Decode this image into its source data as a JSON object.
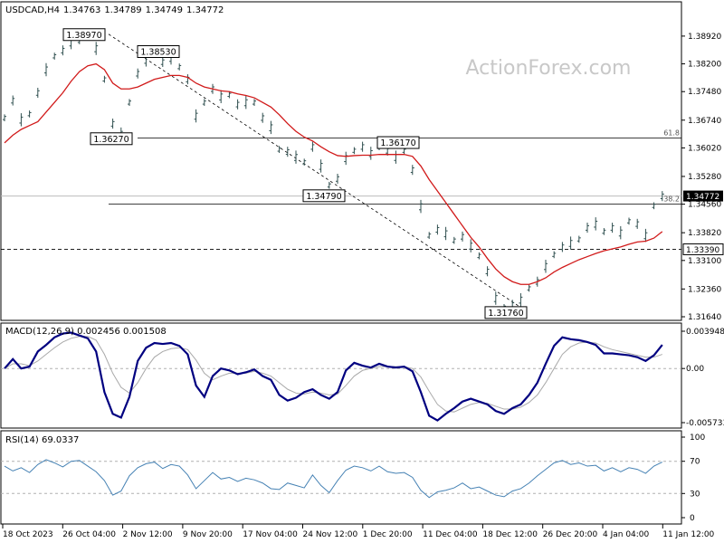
{
  "chart_data": [
    {
      "panel": "price",
      "type": "candlestick",
      "title": "USDCAD,H4",
      "ohlc": [
        "1.34763",
        "1.34789",
        "1.34749",
        "1.34772"
      ],
      "watermark": "ActionForex.com",
      "ylim": [
        1.3164,
        1.3934
      ],
      "yticks": [
        "1.38920",
        "1.38200",
        "1.37480",
        "1.36740",
        "1.36020",
        "1.35280",
        "1.34560",
        "1.33820",
        "1.33100",
        "1.32360",
        "1.31640"
      ],
      "price_tag": "1.34772",
      "level_tag": "1.33390",
      "xticks": [
        "18 Oct 2023",
        "26 Oct 04:00",
        "2 Nov 12:00",
        "9 Nov 20:00",
        "17 Nov 04:00",
        "24 Nov 12:00",
        "1 Dec 20:00",
        "11 Dec 04:00",
        "18 Dec 12:00",
        "26 Dec 20:00",
        "4 Jan 04:00",
        "11 Jan 12:00"
      ],
      "series": [
        {
          "values": [
            1.368,
            1.3725,
            1.3675,
            1.369,
            1.3745,
            1.3805,
            1.384,
            1.3855,
            1.3875,
            1.388,
            1.3895,
            1.386,
            1.378,
            1.3665,
            1.3638,
            1.372,
            1.3795,
            1.383,
            1.3845,
            1.3825,
            1.3835,
            1.3812,
            1.378,
            1.3685,
            1.372,
            1.3755,
            1.3735,
            1.374,
            1.3715,
            1.372,
            1.372,
            1.368,
            1.3655,
            1.3598,
            1.3592,
            1.3578,
            1.3565,
            1.3605,
            1.3555,
            1.3505,
            1.3522,
            1.3575,
            1.3595,
            1.3605,
            1.3588,
            1.3605,
            1.3595,
            1.3578,
            1.3595,
            1.3545,
            1.345,
            1.3375,
            1.339,
            1.338,
            1.3362,
            1.3372,
            1.3348,
            1.3322,
            1.3282,
            1.3212,
            1.3188,
            1.3195,
            1.3208,
            1.3238,
            1.3255,
            1.3295,
            1.3325,
            1.3345,
            1.3355,
            1.3365,
            1.3395,
            1.3405,
            1.3385,
            1.3395,
            1.3382,
            1.3412,
            1.3405,
            1.3375,
            1.3452,
            1.3477
          ]
        },
        {
          "values": [
            1.3615,
            1.3635,
            1.365,
            1.366,
            1.367,
            1.3695,
            1.372,
            1.3745,
            1.3775,
            1.38,
            1.3815,
            1.382,
            1.3805,
            1.377,
            1.3755,
            1.3755,
            1.376,
            1.377,
            1.378,
            1.3785,
            1.379,
            1.379,
            1.3785,
            1.377,
            1.376,
            1.3755,
            1.375,
            1.3748,
            1.3742,
            1.3738,
            1.3732,
            1.372,
            1.3708,
            1.3688,
            1.3665,
            1.3645,
            1.363,
            1.362,
            1.3605,
            1.3592,
            1.3582,
            1.358,
            1.3582,
            1.3583,
            1.3583,
            1.3585,
            1.3585,
            1.3585,
            1.3585,
            1.358,
            1.3555,
            1.352,
            1.349,
            1.346,
            1.343,
            1.34,
            1.337,
            1.3345,
            1.3315,
            1.3288,
            1.3268,
            1.3255,
            1.3248,
            1.3248,
            1.3255,
            1.3265,
            1.328,
            1.3292,
            1.3302,
            1.3312,
            1.332,
            1.3328,
            1.3335,
            1.334,
            1.3345,
            1.3352,
            1.3358,
            1.336,
            1.3368,
            1.3385
          ]
        }
      ],
      "callouts": [
        "1.38970",
        "1.38530",
        "1.36270",
        "1.34790",
        "1.36170",
        "1.31760"
      ],
      "fib_labels": [
        "61.8",
        "38.2"
      ]
    },
    {
      "panel": "macd",
      "type": "line",
      "title": "MACD(12,26,9) 0.002456 0.001508",
      "ylim": [
        -0.005733,
        0.003948
      ],
      "yticks": [
        "0.003948",
        "0.00",
        "-0.005733"
      ],
      "series": [
        {
          "values": [
            0.0,
            0.001,
            0.0,
            0.0002,
            0.0018,
            0.0025,
            0.0033,
            0.0037,
            0.0038,
            0.0035,
            0.0032,
            0.0018,
            -0.0025,
            -0.0048,
            -0.0052,
            -0.003,
            0.0008,
            0.0022,
            0.0027,
            0.0026,
            0.0027,
            0.0024,
            0.0015,
            -0.0018,
            -0.003,
            -0.0008,
            0.0,
            -0.0002,
            -0.0006,
            -0.0004,
            -0.0001,
            -0.0008,
            -0.0012,
            -0.0028,
            -0.0034,
            -0.0031,
            -0.0025,
            -0.0022,
            -0.0028,
            -0.0032,
            -0.0025,
            -0.0002,
            0.0006,
            0.0003,
            0.0001,
            0.0005,
            0.0002,
            0.0001,
            0.0002,
            -0.0003,
            -0.0025,
            -0.005,
            -0.0055,
            -0.0048,
            -0.0042,
            -0.0035,
            -0.0032,
            -0.0035,
            -0.0038,
            -0.0045,
            -0.0048,
            -0.0042,
            -0.0038,
            -0.0028,
            -0.0015,
            0.0005,
            0.0024,
            0.0033,
            0.0031,
            0.003,
            0.0028,
            0.0025,
            0.0016,
            0.0016,
            0.0015,
            0.0014,
            0.0012,
            0.0008,
            0.0014,
            0.0025
          ]
        },
        {
          "values": [
            0.0,
            0.0005,
            0.0005,
            0.0003,
            0.0008,
            0.0015,
            0.0022,
            0.0028,
            0.0032,
            0.0034,
            0.0034,
            0.003,
            0.0015,
            -0.0005,
            -0.002,
            -0.0026,
            -0.0015,
            0.0,
            0.0012,
            0.0018,
            0.0021,
            0.0022,
            0.002,
            0.0009,
            -0.0005,
            -0.0012,
            -0.0008,
            -0.0005,
            -0.0005,
            -0.0005,
            -0.0003,
            -0.0005,
            -0.0008,
            -0.0015,
            -0.0022,
            -0.0026,
            -0.0027,
            -0.0025,
            -0.0026,
            -0.0028,
            -0.0027,
            -0.0018,
            -0.0008,
            -0.0002,
            0.0,
            0.0002,
            0.0002,
            0.0002,
            0.0002,
            0.0,
            -0.0009,
            -0.0024,
            -0.0038,
            -0.0045,
            -0.0046,
            -0.0042,
            -0.0038,
            -0.0036,
            -0.0037,
            -0.004,
            -0.0043,
            -0.0043,
            -0.0041,
            -0.0036,
            -0.0028,
            -0.0015,
            0.0,
            0.0015,
            0.0023,
            0.0027,
            0.0028,
            0.0027,
            0.0023,
            0.002,
            0.0018,
            0.0016,
            0.0014,
            0.0012,
            0.0012,
            0.0015
          ]
        }
      ],
      "colors": {
        "main": "#000080",
        "signal": "#a9a9a9"
      }
    },
    {
      "panel": "rsi",
      "type": "line",
      "title": "RSI(14) 69.0337",
      "ylim": [
        0,
        100
      ],
      "yticks": [
        "100",
        "70",
        "30",
        "0"
      ],
      "levels": [
        70,
        30
      ],
      "series": [
        {
          "values": [
            64,
            58,
            62,
            56,
            66,
            72,
            68,
            63,
            70,
            71,
            64,
            57,
            46,
            28,
            33,
            52,
            62,
            67,
            69,
            61,
            66,
            64,
            53,
            36,
            46,
            56,
            48,
            50,
            45,
            49,
            47,
            43,
            36,
            35,
            43,
            40,
            37,
            53,
            40,
            31,
            46,
            59,
            64,
            62,
            58,
            64,
            57,
            55,
            56,
            50,
            34,
            25,
            32,
            34,
            37,
            43,
            36,
            38,
            33,
            28,
            26,
            33,
            36,
            43,
            52,
            60,
            68,
            71,
            66,
            68,
            64,
            65,
            58,
            62,
            57,
            62,
            60,
            55,
            64,
            69
          ]
        }
      ],
      "colors": {
        "line": "#4682b4"
      }
    }
  ]
}
